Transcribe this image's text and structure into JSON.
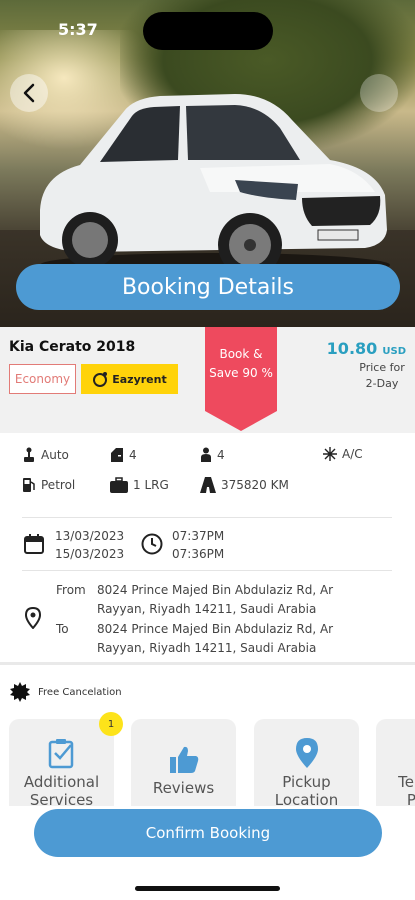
{
  "status_bar": {
    "time": "5:37"
  },
  "hero": {
    "title": "Booking Details"
  },
  "car": {
    "name": "Kia Cerato 2018",
    "category": "Economy",
    "provider": "Eazyrent",
    "promo": "Book & Save 90 %",
    "price": "10.80",
    "currency": "USD",
    "price_note": "Price for 2-Day"
  },
  "specs": {
    "transmission": "Auto",
    "doors": "4",
    "seats": "4",
    "ac": "A/C",
    "fuel": "Petrol",
    "luggage": "1 LRG",
    "mileage": "375820 KM"
  },
  "booking": {
    "pickup_date": "13/03/2023",
    "return_date": "15/03/2023",
    "pickup_time": "07:37PM",
    "return_time": "07:36PM",
    "from_label": "From",
    "to_label": "To",
    "from_address": "8024 Prince Majed Bin Abdulaziz Rd, Ar Rayyan, Riyadh 14211, Saudi Arabia",
    "to_address": "8024 Prince Majed Bin Abdulaziz Rd, Ar Rayyan, Riyadh 14211, Saudi Arabia"
  },
  "free_cancelation": "Free Cancelation",
  "cards": {
    "additional": "Additional Services",
    "additional_badge": "1",
    "reviews": "Reviews",
    "pickup": "Pickup Location",
    "terms": "Terms & Policy"
  },
  "confirm_label": "Confirm Booking",
  "colors": {
    "accent": "#4d9ad3",
    "promo": "#ee4a5e",
    "price": "#2a9fc0",
    "eazyrent": "#ffd30a"
  }
}
